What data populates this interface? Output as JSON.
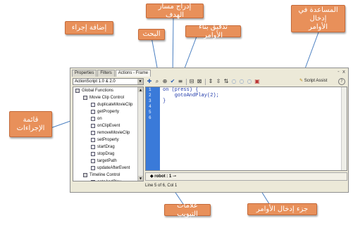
{
  "callouts": {
    "add_action": "إضافة إجراء",
    "insert_target_path": "إدراج مسار الهدف",
    "find": "البحث",
    "check_syntax": "تدقيق بناء الأوامر",
    "script_assist_line1": "المساعدة في إدخال",
    "script_assist_line2": "الأوامر",
    "actions_list_line1": "قائمة",
    "actions_list_line2": "الإجراءات",
    "script_pane": "جزء إدخال الأوامر",
    "tabs_markers": "علامات التبويب"
  },
  "panel": {
    "tabs": [
      "Properties",
      "Filters",
      "Actions - Frame"
    ],
    "active_tab": "Actions - Frame",
    "window_buttons": "- x",
    "version_select": "ActionScript 1.0 & 2.0",
    "script_assist_label": "Script Assist",
    "help": "?"
  },
  "toolbar_icons": [
    "add-action-icon",
    "find-icon",
    "insert-target-path-icon",
    "check-syntax-icon",
    "auto-format-icon",
    "code-hint-icon",
    "debug-options-icon",
    "collapse-between-braces-icon",
    "collapse-selection-icon",
    "expand-all-icon",
    "apply-block-comment-icon",
    "apply-line-comment-icon",
    "remove-comment-icon",
    "show-hide-toolbox-icon"
  ],
  "actions_list": [
    {
      "label": "Global Functions",
      "indent": 0,
      "kind": "book"
    },
    {
      "label": "Movie Clip Control",
      "indent": 1,
      "kind": "book"
    },
    {
      "label": "duplicateMovieClip",
      "indent": 2,
      "kind": "action"
    },
    {
      "label": "getProperty",
      "indent": 2,
      "kind": "action"
    },
    {
      "label": "on",
      "indent": 2,
      "kind": "action"
    },
    {
      "label": "onClipEvent",
      "indent": 2,
      "kind": "action"
    },
    {
      "label": "removeMovieClip",
      "indent": 2,
      "kind": "action"
    },
    {
      "label": "setProperty",
      "indent": 2,
      "kind": "action"
    },
    {
      "label": "startDrag",
      "indent": 2,
      "kind": "action"
    },
    {
      "label": "stopDrag",
      "indent": 2,
      "kind": "action"
    },
    {
      "label": "targetPath",
      "indent": 2,
      "kind": "action"
    },
    {
      "label": "updateAfterEvent",
      "indent": 2,
      "kind": "action"
    },
    {
      "label": "Timeline Control",
      "indent": 1,
      "kind": "book"
    },
    {
      "label": "gotoAndPlay",
      "indent": 2,
      "kind": "action"
    }
  ],
  "editor": {
    "line_numbers": [
      "1",
      "2",
      "3",
      "4",
      "5",
      "6"
    ],
    "code_lines": [
      "on (press) {",
      "    gotoAndPlay(2);",
      "",
      "}",
      "",
      ""
    ]
  },
  "tag_bar": {
    "tab_label": "robot : 1"
  },
  "status_bar": "Line 5 of 6, Col 1",
  "colors": {
    "callout_bg": "#e8905a",
    "gutter": "#3a7ad9",
    "code": "#1b35a8",
    "callout_line": "#4a7fc1"
  }
}
